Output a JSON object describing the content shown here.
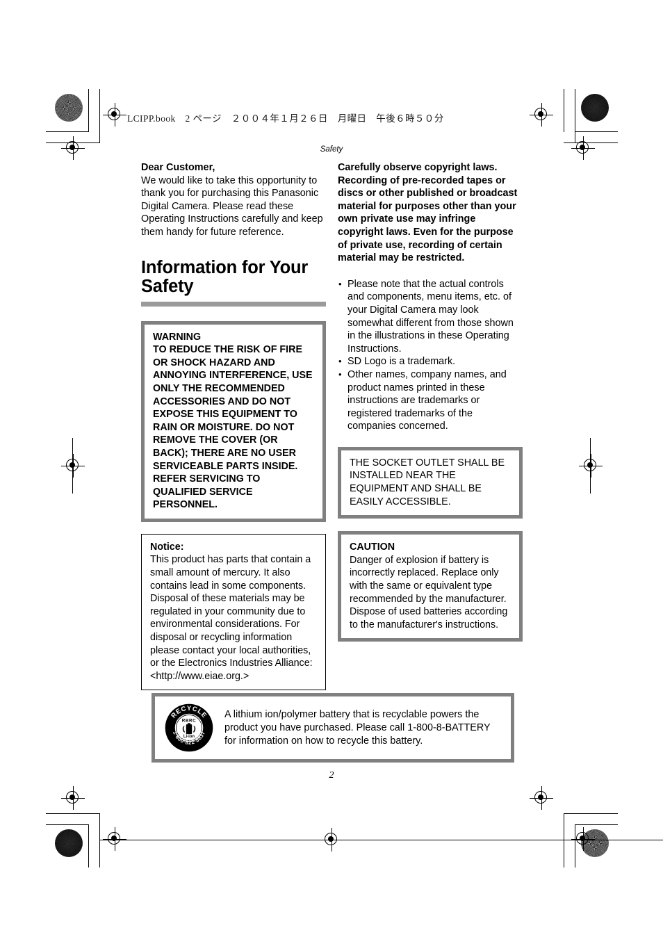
{
  "header": {
    "book_line": "LCIPP.book　2 ページ　２００４年１月２６日　月曜日　午後６時５０分",
    "running_head": "Safety"
  },
  "left_column": {
    "lead_title": "Dear Customer,",
    "lead_body": "We would like to take this opportunity to thank you for purchasing this Panasonic Digital Camera. Please read these Operating Instructions carefully and keep them handy for future reference.",
    "section_title": "Information for Your Safety",
    "warning_box": {
      "heading": "WARNING",
      "body": "TO REDUCE THE RISK OF FIRE OR SHOCK HAZARD AND ANNOYING INTERFERENCE, USE ONLY THE RECOMMENDED ACCESSORIES AND DO NOT EXPOSE THIS EQUIPMENT TO RAIN OR MOISTURE. DO NOT REMOVE THE COVER (OR BACK); THERE ARE NO USER SERVICEABLE PARTS INSIDE. REFER SERVICING TO QUALIFIED SERVICE PERSONNEL."
    },
    "notice_box": {
      "heading": "Notice:",
      "body": "This product has parts that contain a small amount of mercury. It also contains lead in some components. Disposal of these materials may be regulated in your community due to environmental considerations. For disposal or recycling information please contact your local authorities, or the Electronics Industries Alliance: <http://www.eiae.org.>"
    }
  },
  "right_column": {
    "copyright_notice": "Carefully observe copyright laws. Recording of pre-recorded tapes or discs or other published or broadcast material for purposes other than your own private use may infringe copyright laws. Even for the purpose of private use, recording of certain material may be restricted.",
    "bullets": [
      "Please note that the actual controls and components, menu items, etc. of your Digital Camera may look somewhat different from those shown in the illustrations in these Operating Instructions.",
      "SD Logo is a trademark.",
      "Other names, company names, and product names printed in these instructions are trademarks or registered trademarks of the companies concerned."
    ],
    "socket_box": {
      "body": "THE SOCKET OUTLET SHALL BE INSTALLED NEAR THE EQUIPMENT AND SHALL BE EASILY ACCESSIBLE."
    },
    "caution_box": {
      "heading": "CAUTION",
      "body": "Danger of explosion if battery is incorrectly replaced. Replace only with the same or equivalent type recommended by the manufacturer. Dispose of used batteries according to the manufacturer's instructions."
    }
  },
  "recycle_panel": {
    "logo": {
      "top_arc": "RECYCLE",
      "bottom_arc": "1·800·822·8837",
      "inner_top": "RBRC",
      "inner_bottom": "Li-ion"
    },
    "text": "A lithium ion/polymer battery that is recyclable powers the product you have purchased. Please call 1-800-8-BATTERY for information on how to recycle this battery."
  },
  "footer": {
    "page_number": "2"
  },
  "colors": {
    "box_border_gray": "#808080",
    "title_rule_gray": "#9a9a9a",
    "text_black": "#000000",
    "page_background": "#ffffff"
  }
}
